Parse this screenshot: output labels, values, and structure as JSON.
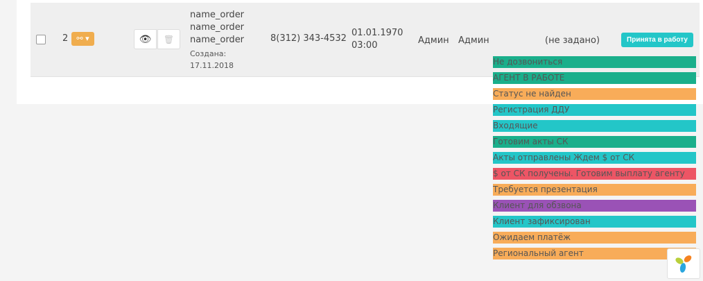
{
  "row": {
    "number": "2",
    "link_glyph": "⚯ ▾",
    "view_glyph": "👁",
    "delete_glyph": "🗑",
    "names": [
      "name_order",
      "name_order",
      "name_order"
    ],
    "created_label": "Создана:",
    "created_date": "17.11.2018",
    "phone": "8(312) 343-4532",
    "date": "01.01.1970",
    "time": "03:00",
    "admin1": "Админ",
    "admin2": "Админ",
    "not_set": "(не задано)",
    "accept_button": "Принята в работу"
  },
  "colors": {
    "green": "#1aaf8b",
    "orange": "#f8ac59",
    "cyan": "#23c6c8",
    "red": "#ed5565",
    "purple": "#9a52b6"
  },
  "statuses": [
    {
      "label": "Не дозвониться",
      "color": "#1aaf8b"
    },
    {
      "label": "АГЕНТ В РАБОТЕ",
      "color": "#1aaf8b"
    },
    {
      "label": "Статус не найден",
      "color": "#f8ac59"
    },
    {
      "label": "Регистрация ДДУ",
      "color": "#23c6c8"
    },
    {
      "label": "Входящие",
      "color": "#23c6c8"
    },
    {
      "label": "Готовим акты СК",
      "color": "#1aaf8b"
    },
    {
      "label": "Акты отправлены Ждем $ от СК",
      "color": "#23c6c8"
    },
    {
      "label": "$ от СК получены. Готовим выплату агенту",
      "color": "#ed5565"
    },
    {
      "label": "Требуется презентация",
      "color": "#f8ac59"
    },
    {
      "label": "Клиент для обзвона",
      "color": "#9a52b6"
    },
    {
      "label": "Клиент зафиксирован",
      "color": "#23c6c8"
    },
    {
      "label": "Ожидаем платёж",
      "color": "#f8ac59"
    },
    {
      "label": "Региональный агент",
      "color": "#f8ac59"
    }
  ]
}
